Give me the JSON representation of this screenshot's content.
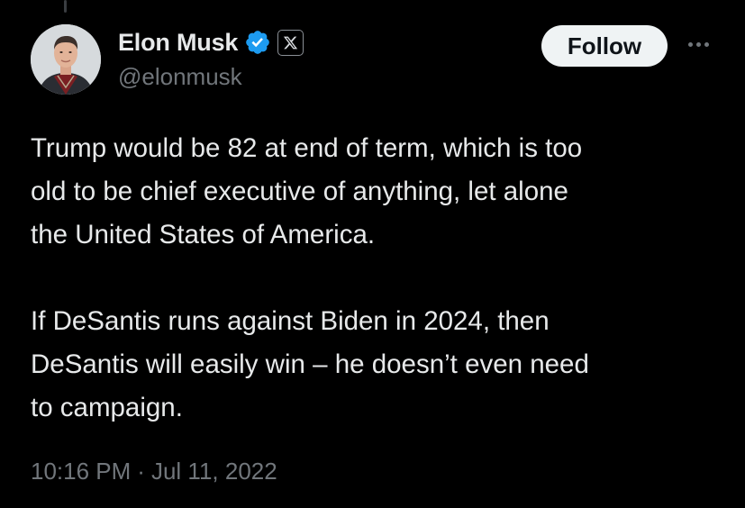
{
  "author": {
    "display_name": "Elon Musk",
    "handle": "@elonmusk",
    "verified_icon": "verified-badge-icon",
    "affiliate_icon": "x-logo-icon"
  },
  "actions": {
    "follow_label": "Follow",
    "more_icon": "more-options-icon"
  },
  "tweet": {
    "paragraphs": [
      "Trump would be 82 at end of term, which is too\nold to be chief executive of anything, let alone\nthe United States of America.",
      "If DeSantis runs against Biden in 2024, then\nDeSantis will easily win – he doesn’t even need\nto campaign."
    ],
    "time": "10:16 PM",
    "separator": "·",
    "date": "Jul 11, 2022"
  },
  "colors": {
    "background": "#000000",
    "text_primary": "#e7e9ea",
    "text_secondary": "#71767b",
    "verified_blue": "#1d9bf0",
    "follow_bg": "#eff3f4"
  }
}
